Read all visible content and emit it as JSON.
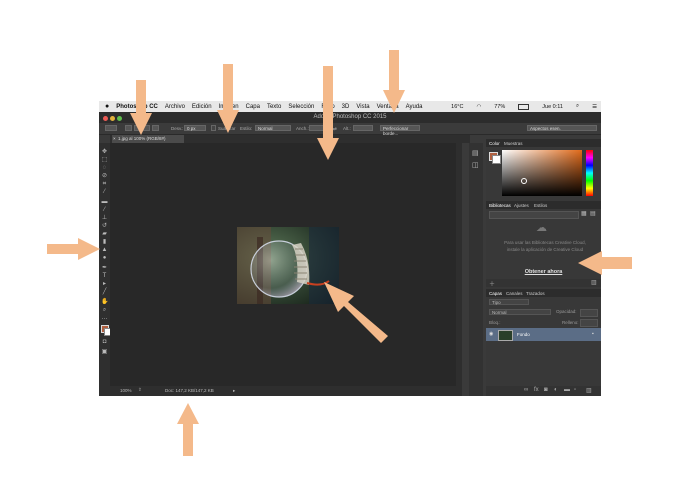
{
  "menubar": {
    "app": "Photoshop CC",
    "items": [
      "Archivo",
      "Edición",
      "Imagen",
      "Capa",
      "Texto",
      "Selección",
      "Filtro",
      "3D",
      "Vista",
      "Ventana",
      "Ayuda"
    ],
    "temp": "16°C",
    "battery": "77%",
    "clock": "Jue 0:11"
  },
  "window": {
    "title": "Adobe Photoshop CC 2015"
  },
  "options_bar": {
    "feather_label": "Desv.:",
    "feather_value": "0 px",
    "smooth_label": "Suavizar",
    "style_label": "Estilo:",
    "style_value": "Normal",
    "width_label": "Anch.:",
    "height_label": "Alt.:",
    "refine_label": "Perfeccionar borde...",
    "workspace": "Aspectos esen."
  },
  "document": {
    "tab": "1.jpg al 100% (RGB/8#)"
  },
  "statusbar": {
    "zoom": "100%",
    "doc_info": "Doc: 147,2 KB/147,2 KB"
  },
  "color_panel": {
    "tabs": [
      "Color",
      "Muestras"
    ],
    "fg": "#b06040",
    "bg": "#ffffff"
  },
  "libraries_panel": {
    "tabs": [
      "Bibliotecas",
      "Ajustes",
      "Estilos"
    ],
    "message": "Para usar las Bibliotecas Creative Cloud, instale la aplicación de Creative Cloud",
    "link": "Obtener ahora"
  },
  "layers_panel": {
    "tabs": [
      "Capas",
      "Canales",
      "Trazados"
    ],
    "kind_label": "Tipo",
    "blend_mode": "Normal",
    "opacity_label": "Opacidad:",
    "lock_label": "Bloq.:",
    "fill_label": "Relleno:",
    "layer_name": "Fondo"
  },
  "annotation": {
    "arrow_color": "#f4b98a"
  }
}
